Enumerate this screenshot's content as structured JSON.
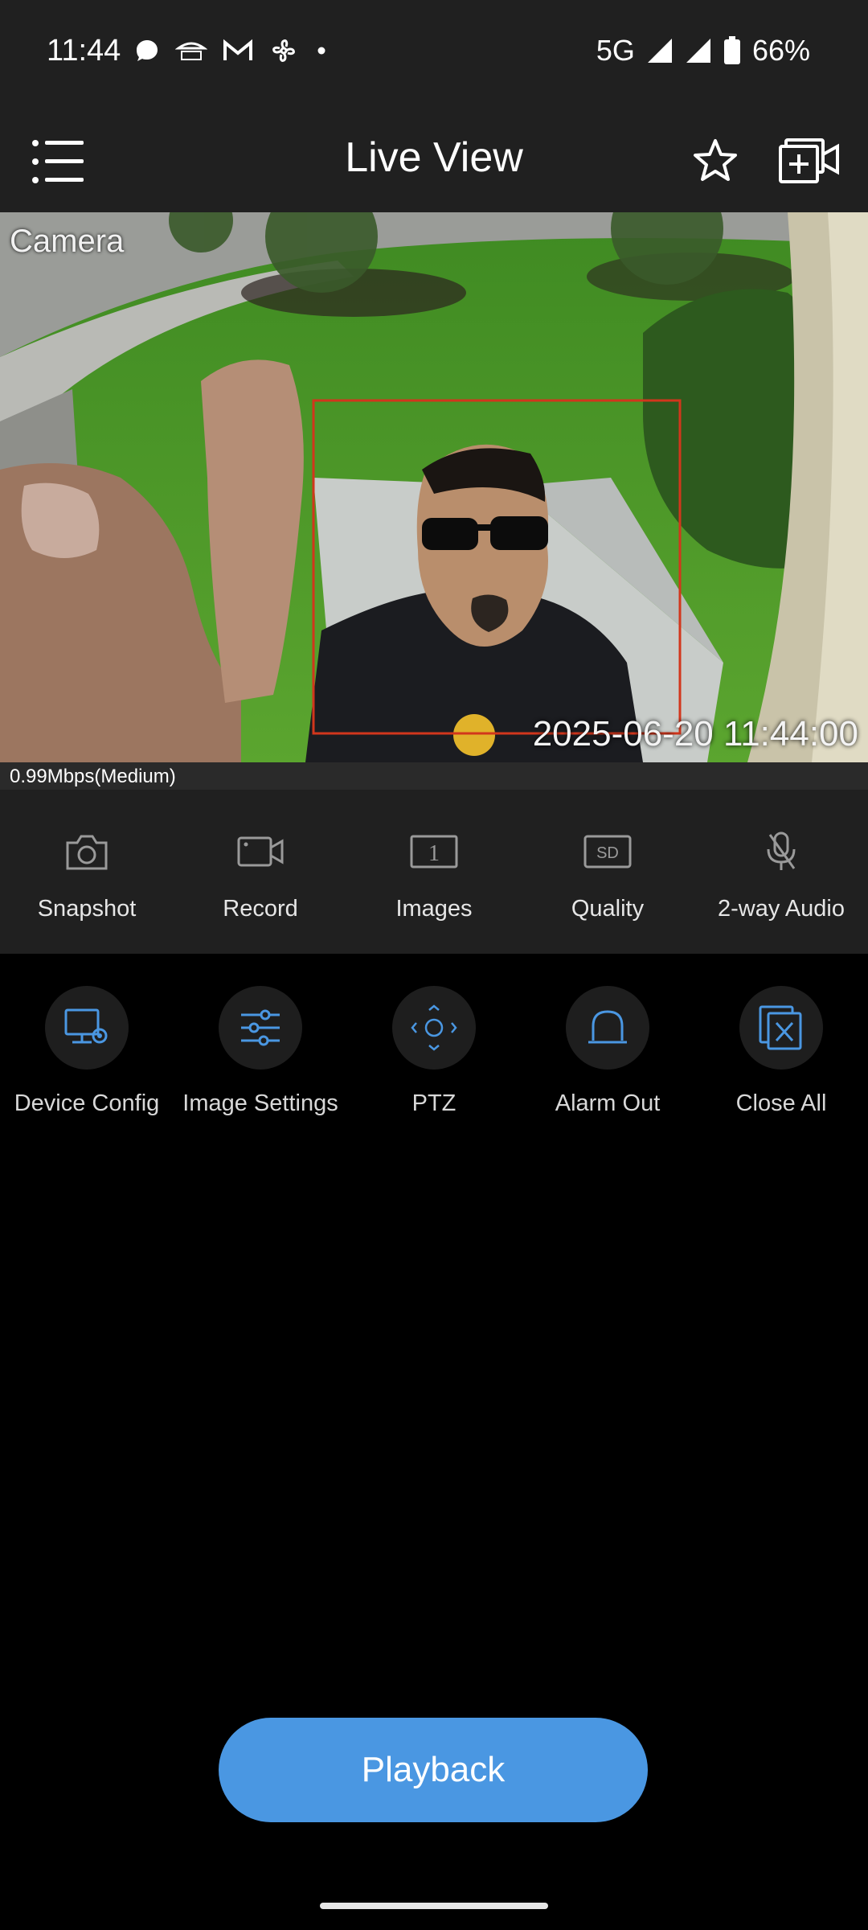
{
  "status_bar": {
    "time": "11:44",
    "network": "5G",
    "battery": "66%",
    "notification_icons": [
      "chat-icon",
      "pizza-hut-icon",
      "gmail-icon",
      "fan-icon",
      "dot-icon"
    ]
  },
  "app_bar": {
    "title": "Live View",
    "menu_icon": "hamburger-menu-icon",
    "favorite_icon": "star-icon",
    "add_camera_icon": "add-camera-icon"
  },
  "video": {
    "camera_label": "Camera",
    "timestamp": "2025-06-20 11:44:00",
    "bitrate": "0.99Mbps(Medium)"
  },
  "toolbar": {
    "items": [
      {
        "label": "Snapshot",
        "icon": "camera-icon"
      },
      {
        "label": "Record",
        "icon": "video-record-icon"
      },
      {
        "label": "Images",
        "icon": "images-icon",
        "badge": "1"
      },
      {
        "label": "Quality",
        "icon": "sd-quality-icon",
        "badge": "SD"
      },
      {
        "label": "2-way Audio",
        "icon": "microphone-muted-icon"
      }
    ]
  },
  "actions": {
    "items": [
      {
        "label": "Device Config",
        "icon": "device-config-icon"
      },
      {
        "label": "Image Settings",
        "icon": "sliders-icon"
      },
      {
        "label": "PTZ",
        "icon": "ptz-icon"
      },
      {
        "label": "Alarm Out",
        "icon": "alarm-bell-icon"
      },
      {
        "label": "Close All",
        "icon": "close-all-icon"
      }
    ]
  },
  "playback_label": "Playback",
  "colors": {
    "accent": "#4a97e2",
    "bar_bg": "#202020",
    "detection_box": "#d2361c"
  }
}
